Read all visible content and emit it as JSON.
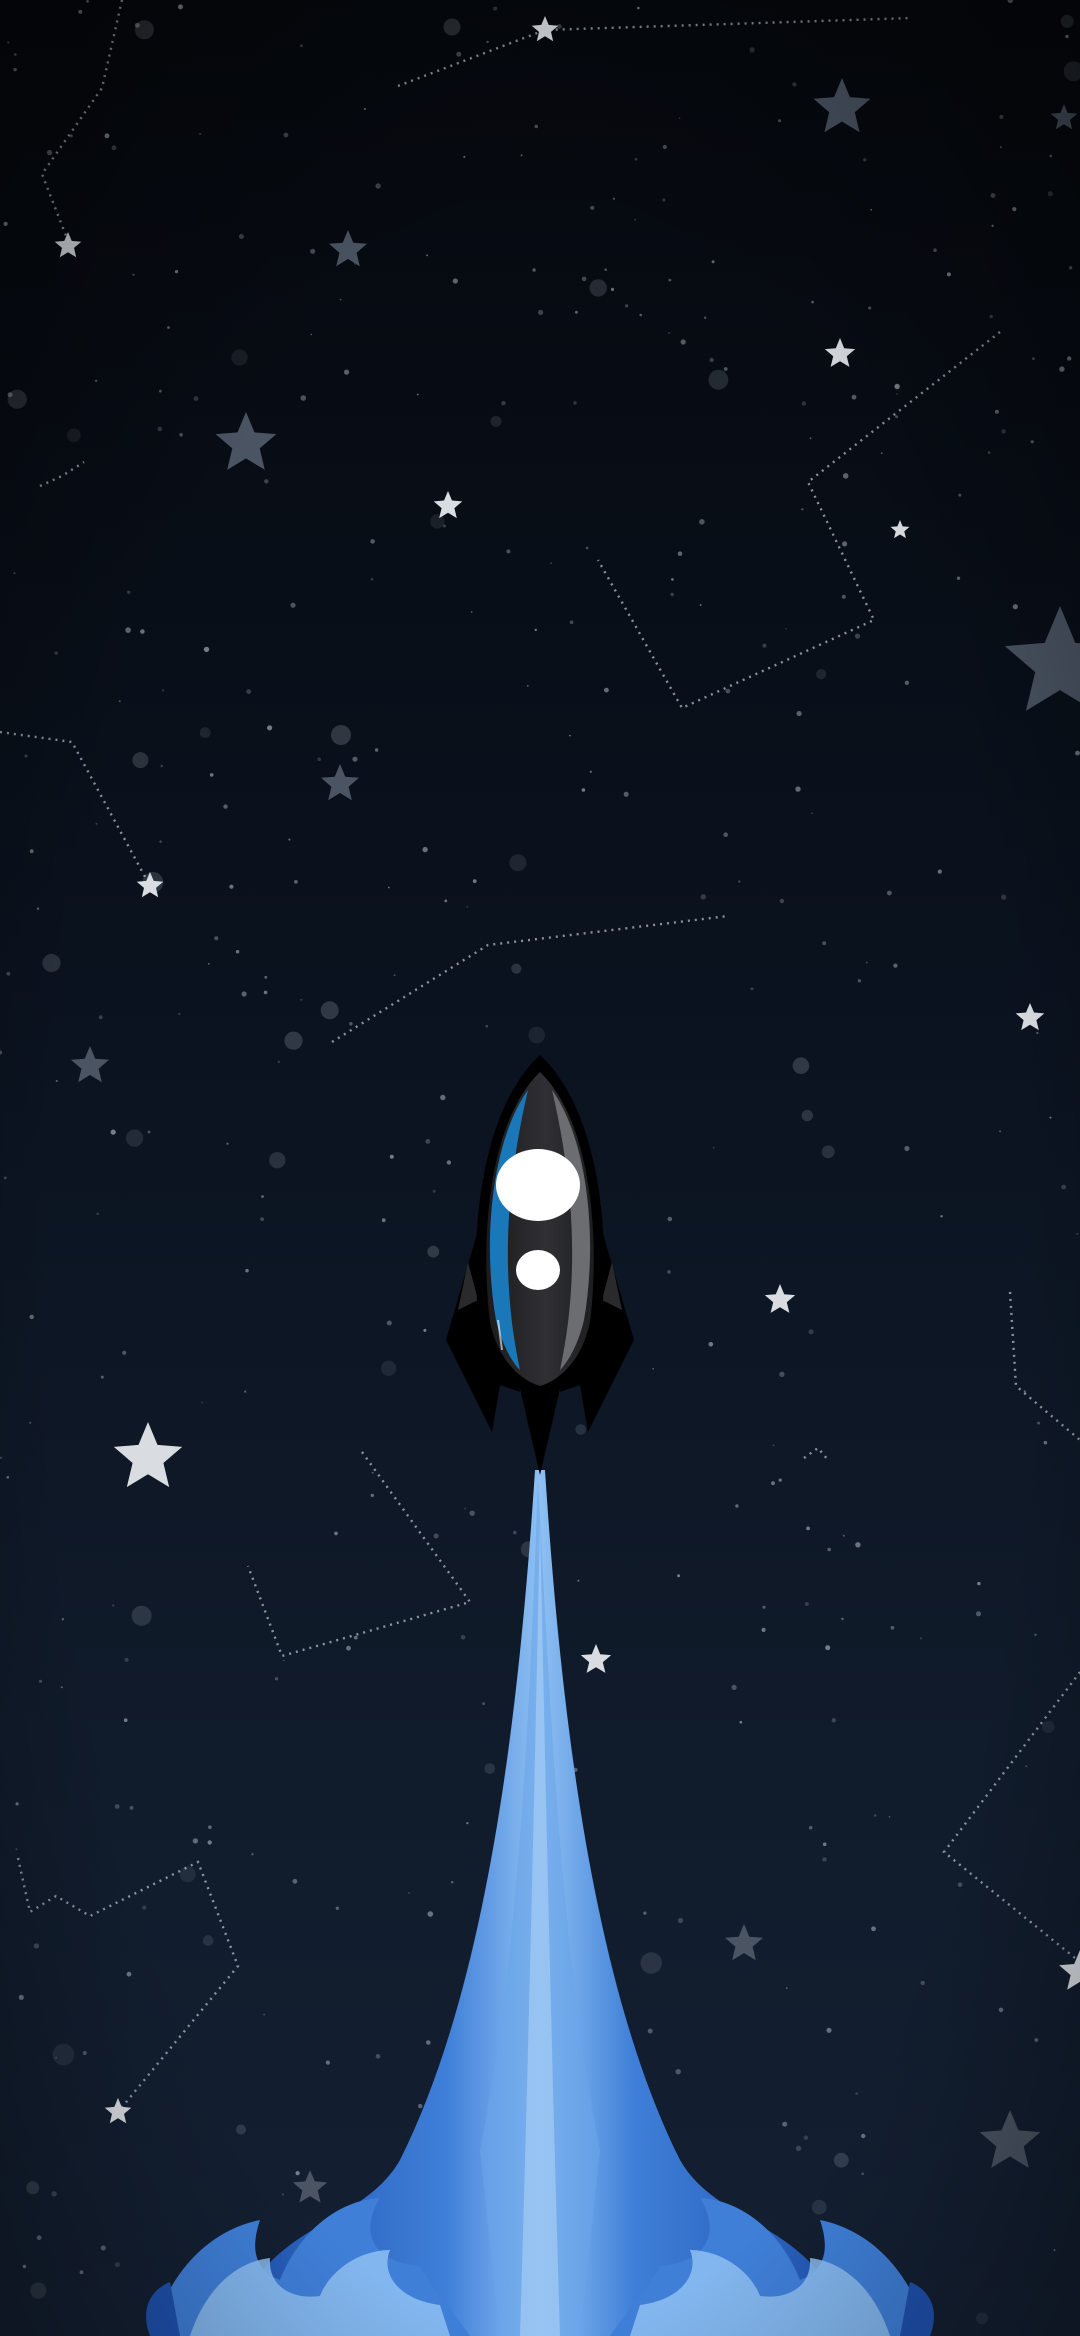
{
  "scene": {
    "description_label": "",
    "colors": {
      "sky_top": "#05080d",
      "sky_bottom": "#142033",
      "star_bright": "#d9dde2",
      "star_dim": "#4a5463",
      "constellation": "#b8bec7",
      "rocket_body": "#2f2f32",
      "rocket_outline": "#000000",
      "rocket_stripe_blue": "#1a78b8",
      "rocket_stripe_grey": "#6b6d70",
      "window": "#ffffff",
      "flame_dark": "#1f52b0",
      "flame_mid": "#3f7fd8",
      "flame_light": "#8ec0f2"
    },
    "icons": [
      "rocket-icon",
      "star-icon",
      "constellation-icon",
      "exhaust-flame-icon"
    ]
  }
}
